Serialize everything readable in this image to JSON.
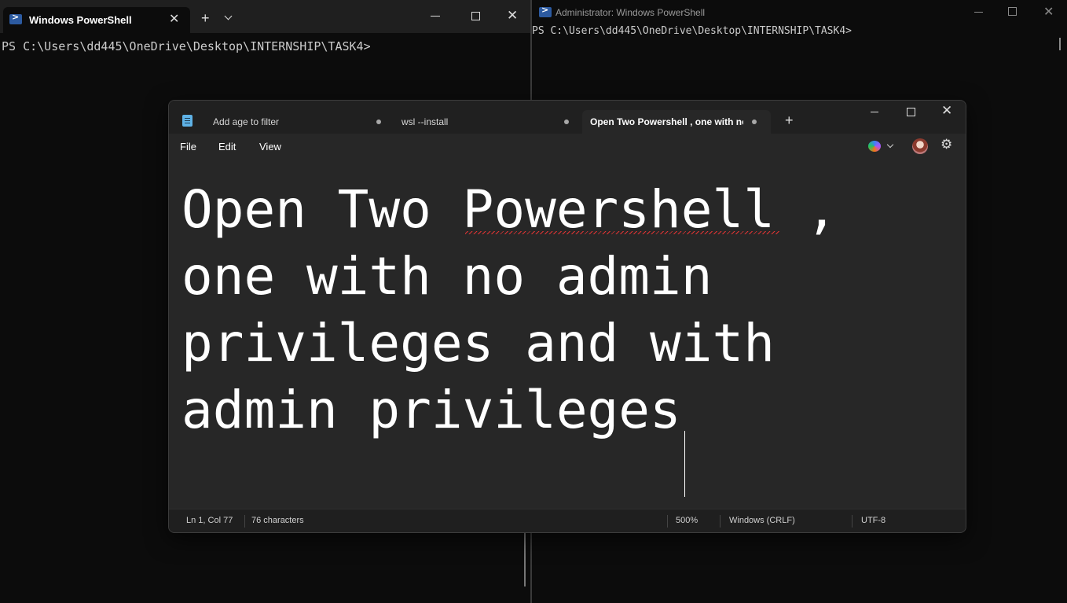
{
  "left_terminal": {
    "tab_title": "Windows PowerShell",
    "close_glyph": "✕",
    "new_tab_glyph": "+",
    "close_window_glyph": "✕",
    "prompt": "PS C:\\Users\\dd445\\OneDrive\\Desktop\\INTERNSHIP\\TASK4>"
  },
  "right_terminal": {
    "title": "Administrator: Windows PowerShell",
    "close_window_glyph": "✕",
    "prompt": "PS C:\\Users\\dd445\\OneDrive\\Desktop\\INTERNSHIP\\TASK4>"
  },
  "notepad": {
    "tabs": [
      {
        "label": "Add age to filter"
      },
      {
        "label": "wsl --install"
      },
      {
        "label": "Open Two Powershell , one with no admin privileges and with admin privileges"
      }
    ],
    "new_tab_glyph": "+",
    "close_window_glyph": "✕",
    "menu": {
      "file": "File",
      "edit": "Edit",
      "view": "View"
    },
    "settings_glyph": "⚙",
    "content": "Open Two Powershell , one with no admin privileges and with admin privileges",
    "status": {
      "position": "Ln 1, Col 77",
      "characters": "76 characters",
      "zoom": "500%",
      "line_ending": "Windows (CRLF)",
      "encoding": "UTF-8"
    }
  },
  "colors": {
    "terminal_bg": "#0c0c0c",
    "notepad_bg": "#272727",
    "powershell_icon": "#2c5aa0",
    "spellcheck": "#dd3333"
  }
}
